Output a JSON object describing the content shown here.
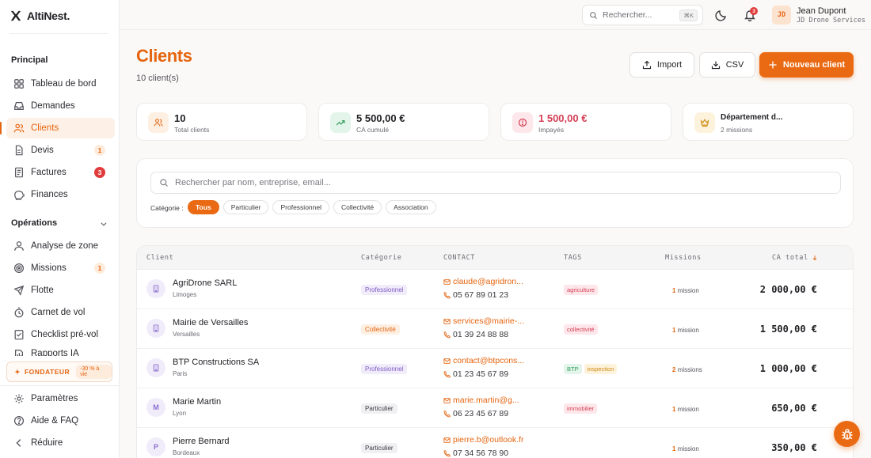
{
  "app": {
    "name": "AltiNest."
  },
  "sidebar": {
    "principal_title": "Principal",
    "principal": [
      {
        "label": "Tableau de bord",
        "icon": "dashboard-icon"
      },
      {
        "label": "Demandes",
        "icon": "inbox-icon"
      },
      {
        "label": "Clients",
        "icon": "users-icon",
        "active": true
      },
      {
        "label": "Devis",
        "icon": "document-icon",
        "badge": "1"
      },
      {
        "label": "Factures",
        "icon": "receipt-icon",
        "badge": "3"
      },
      {
        "label": "Finances",
        "icon": "piggy-bank-icon"
      }
    ],
    "operations_title": "Opérations",
    "operations": [
      {
        "label": "Analyse de zone",
        "icon": "map-pin-icon"
      },
      {
        "label": "Missions",
        "icon": "target-icon",
        "badge": "1"
      },
      {
        "label": "Flotte",
        "icon": "plane-icon"
      },
      {
        "label": "Carnet de vol",
        "icon": "timer-icon"
      },
      {
        "label": "Checklist pré-vol",
        "icon": "checklist-icon"
      },
      {
        "label": "Rapports IA",
        "icon": "report-icon"
      }
    ],
    "founder": {
      "label": "FONDATEUR",
      "pill": "-30 % à vie"
    },
    "bottom": [
      {
        "label": "Paramètres",
        "icon": "gear-icon"
      },
      {
        "label": "Aide & FAQ",
        "icon": "help-icon"
      },
      {
        "label": "Réduire",
        "icon": "chevron-left-icon"
      }
    ]
  },
  "topbar": {
    "search_placeholder": "Rechercher...",
    "shortcut": "⌘K",
    "notifications": "3",
    "avatar_initials": "JD",
    "user_name": "Jean Dupont",
    "user_org": "JD Drone Services"
  },
  "page": {
    "title": "Clients",
    "count": "10 client(s)",
    "buttons": {
      "import": "Import",
      "csv": "CSV",
      "new": "Nouveau client"
    }
  },
  "stats": [
    {
      "value": "10",
      "label": "Total clients",
      "icon": "users-icon",
      "bg": "#fdefe2",
      "fg": "#e5640f",
      "color": "#1f1f24"
    },
    {
      "value": "5 500,00 €",
      "label": "CA cumulé",
      "icon": "trend-up-icon",
      "bg": "#e3f5ea",
      "fg": "#2e9c5a",
      "color": "#1f1f24"
    },
    {
      "value": "1 500,00 €",
      "label": "Impayés",
      "icon": "alert-circle-icon",
      "bg": "#fde7ea",
      "fg": "#d43f56",
      "color": "#d43f56"
    },
    {
      "value": "Département d...",
      "label": "2 missions",
      "icon": "crown-icon",
      "bg": "#fdf3dc",
      "fg": "#cf8a12",
      "color": "#1f1f24"
    }
  ],
  "filters": {
    "search_placeholder": "Rechercher par nom, entreprise, email...",
    "category_label": "Catégorie :",
    "chips": [
      {
        "label": "Tous",
        "active": true
      },
      {
        "label": "Particulier"
      },
      {
        "label": "Professionnel"
      },
      {
        "label": "Collectivité"
      },
      {
        "label": "Association"
      }
    ]
  },
  "table": {
    "headers": {
      "client": "Client",
      "category": "Catégorie",
      "contact": "CONTACT",
      "tags": "TAGS",
      "missions": "Missions",
      "ca": "CA total"
    },
    "rows": [
      {
        "name": "AgriDrone SARL",
        "city": "Limoges",
        "avatar": "building",
        "category": "Professionnel",
        "cat_class": "pro",
        "email": "claude@agridron...",
        "phone": "05 67 89 01 23",
        "tags": [
          {
            "label": "agriculture",
            "class": "pink"
          }
        ],
        "mission_count": "1",
        "mission_word": "mission",
        "amount": "2 000,00 €"
      },
      {
        "name": "Mairie de Versailles",
        "city": "Versailles",
        "avatar": "building",
        "category": "Collectivité",
        "cat_class": "col",
        "email": "services@mairie-...",
        "phone": "01 39 24 88 88",
        "tags": [
          {
            "label": "collectivité",
            "class": "pink"
          }
        ],
        "mission_count": "1",
        "mission_word": "mission",
        "amount": "1 500,00 €"
      },
      {
        "name": "BTP Constructions SA",
        "city": "Paris",
        "avatar": "building",
        "category": "Professionnel",
        "cat_class": "pro",
        "email": "contact@btpcons...",
        "phone": "01 23 45 67 89",
        "tags": [
          {
            "label": "BTP",
            "class": "green"
          },
          {
            "label": "inspection",
            "class": "amber"
          }
        ],
        "mission_count": "2",
        "mission_word": "missions",
        "amount": "1 000,00 €"
      },
      {
        "name": "Marie Martin",
        "city": "Lyon",
        "avatar": "M",
        "category": "Particulier",
        "cat_class": "par",
        "email": "marie.martin@g...",
        "phone": "06 23 45 67 89",
        "tags": [
          {
            "label": "immobilier",
            "class": "pink"
          }
        ],
        "mission_count": "1",
        "mission_word": "mission",
        "amount": "650,00 €"
      },
      {
        "name": "Pierre Bernard",
        "city": "Bordeaux",
        "avatar": "P",
        "category": "Particulier",
        "cat_class": "par",
        "email": "pierre.b@outlook.fr",
        "phone": "07 34 56 78 90",
        "tags": [],
        "mission_count": "1",
        "mission_word": "mission",
        "amount": "350,00 €"
      }
    ]
  },
  "fab": {
    "icon": "bug-icon"
  }
}
